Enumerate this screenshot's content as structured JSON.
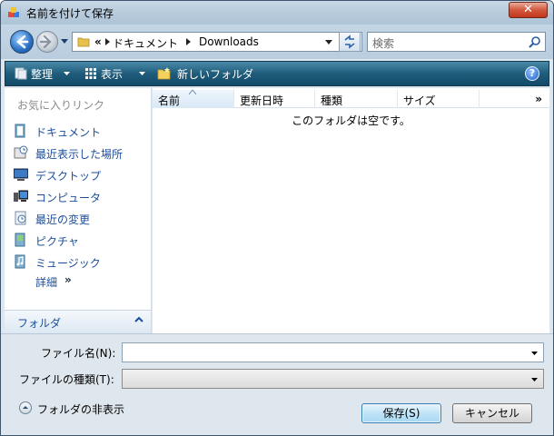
{
  "window": {
    "title": "名前を付けて保存",
    "close_label": "✕"
  },
  "address": {
    "overflow": "«",
    "crumbs": [
      "ドキュメント",
      "Downloads"
    ]
  },
  "search": {
    "placeholder": "検索"
  },
  "toolbar": {
    "organize": "整理",
    "view": "表示",
    "new_folder": "新しいフォルダ",
    "help": "?"
  },
  "sidebar": {
    "favorites_title": "お気に入りリンク",
    "items": [
      {
        "label": "ドキュメント",
        "icon": "documents-icon"
      },
      {
        "label": "最近表示した場所",
        "icon": "recent-places-icon"
      },
      {
        "label": "デスクトップ",
        "icon": "desktop-icon"
      },
      {
        "label": "コンピュータ",
        "icon": "computer-icon"
      },
      {
        "label": "最近の変更",
        "icon": "recent-changes-icon"
      },
      {
        "label": "ピクチャ",
        "icon": "pictures-icon"
      },
      {
        "label": "ミュージック",
        "icon": "music-icon"
      }
    ],
    "more_label": "詳細",
    "more_arrows": "»",
    "folders_label": "フォルダ"
  },
  "filelist": {
    "columns": [
      "名前",
      "更新日時",
      "種類",
      "サイズ"
    ],
    "overflow": "»",
    "empty_message": "このフォルダは空です。"
  },
  "form": {
    "filename_label": "ファイル名(N):",
    "filename_value": "",
    "filetype_label": "ファイルの種類(T):",
    "filetype_value": ""
  },
  "footer": {
    "hide_folders": "フォルダの非表示",
    "save_button": "保存(S)",
    "cancel_button": "キャンセル"
  }
}
